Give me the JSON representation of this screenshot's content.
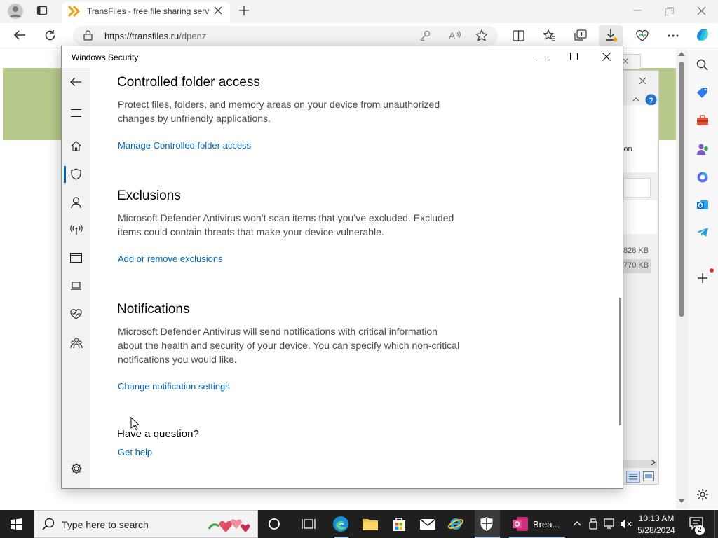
{
  "browser": {
    "tab_title": "TransFiles - free file sharing serv",
    "url_scheme": "https://transfiles.ru",
    "url_path": "/dpenz"
  },
  "background_dialog": {
    "text_fragment": "ion",
    "size_1": "828 KB",
    "size_2": "770 KB"
  },
  "windows_security": {
    "title": "Windows Security",
    "sections": [
      {
        "heading": "Controlled folder access",
        "body": "Protect files, folders, and memory areas on your device from unauthorized changes by unfriendly applications.",
        "link": "Manage Controlled folder access"
      },
      {
        "heading": "Exclusions",
        "body": "Microsoft Defender Antivirus won’t scan items that you’ve excluded. Excluded items could contain threats that make your device vulnerable.",
        "link": "Add or remove exclusions"
      },
      {
        "heading": "Notifications",
        "body": "Microsoft Defender Antivirus will send notifications with critical information about the health and security of your device. You can specify which non-critical notifications you would like.",
        "link": "Change notification settings"
      }
    ],
    "question": "Have a question?",
    "help_link": "Get help",
    "nav_icons": [
      "back-arrow-icon",
      "hamburger-menu-icon",
      "home-icon",
      "shield-icon",
      "account-icon",
      "network-icon",
      "app-browser-icon",
      "device-icon",
      "heart-health-icon",
      "family-icon",
      "settings-gear-icon"
    ]
  },
  "taskbar": {
    "search_placeholder": "Type here to search",
    "active_app_label": "Brea...",
    "time": "10:13 AM",
    "date": "5/28/2024",
    "notification_count": "2"
  },
  "colors": {
    "link_blue": "#0067b8",
    "nav_selection": "#0063b1",
    "page_banner": "#b6c98a",
    "taskbar": "#1f1f1f"
  }
}
